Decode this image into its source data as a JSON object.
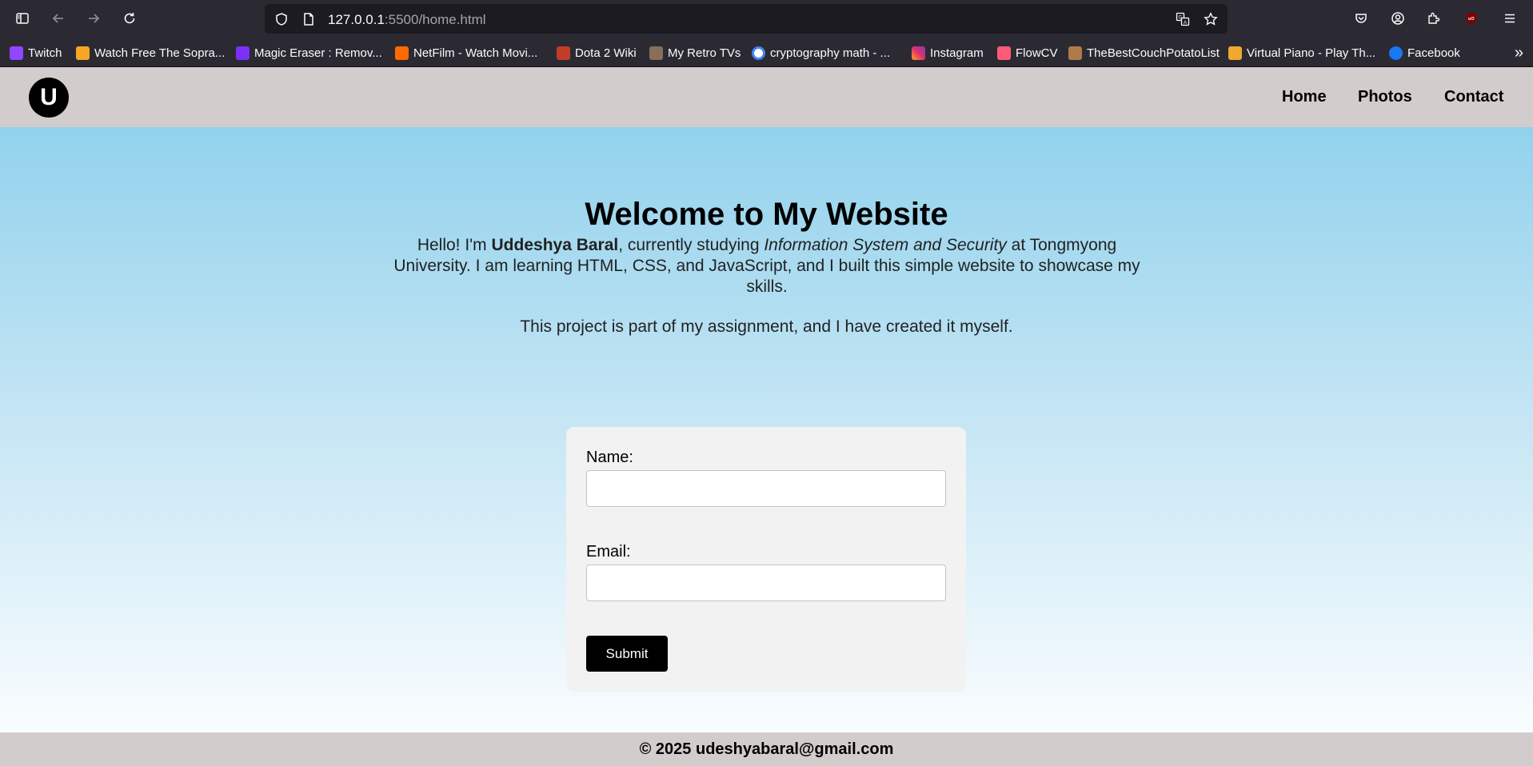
{
  "browser": {
    "url_host": "127.0.0.1",
    "url_path": ":5500/home.html",
    "bookmarks": [
      {
        "label": "Twitch",
        "color": "#9146ff"
      },
      {
        "label": "Watch Free The Sopra...",
        "color": "#f5a623"
      },
      {
        "label": "Magic Eraser : Remov...",
        "color": "#7b2ff7"
      },
      {
        "label": "NetFilm - Watch Movi...",
        "color": "#ff6a00"
      },
      {
        "label": "Dota 2 Wiki",
        "color": "#c23c2a"
      },
      {
        "label": "My Retro TVs",
        "color": "#8a6d5a"
      },
      {
        "label": "cryptography math - ...",
        "color": "#4285f4"
      },
      {
        "label": "Instagram",
        "color": "#e1306c"
      },
      {
        "label": "FlowCV",
        "color": "#ff5a7a"
      },
      {
        "label": "TheBestCouchPotatoList",
        "color": "#b07a4a"
      },
      {
        "label": "Virtual Piano - Play Th...",
        "color": "#f0a830"
      },
      {
        "label": "Facebook",
        "color": "#1877f2"
      }
    ]
  },
  "site": {
    "logo_letter": "U",
    "nav": [
      "Home",
      "Photos",
      "Contact"
    ],
    "title": "Welcome to My Website",
    "intro_prefix": "Hello! I'm ",
    "intro_name": "Uddeshya Baral",
    "intro_mid": ", currently studying ",
    "intro_field": "Information System and Security",
    "intro_suffix": " at Tongmyong University. I am learning HTML, CSS, and JavaScript, and I built this simple website to showcase my skills.",
    "intro_second": "This project is part of my assignment, and I have created it myself.",
    "form": {
      "name_label": "Name:",
      "email_label": "Email:",
      "submit_label": "Submit"
    },
    "footer": "© 2025 udeshyabaral@gmail.com"
  }
}
